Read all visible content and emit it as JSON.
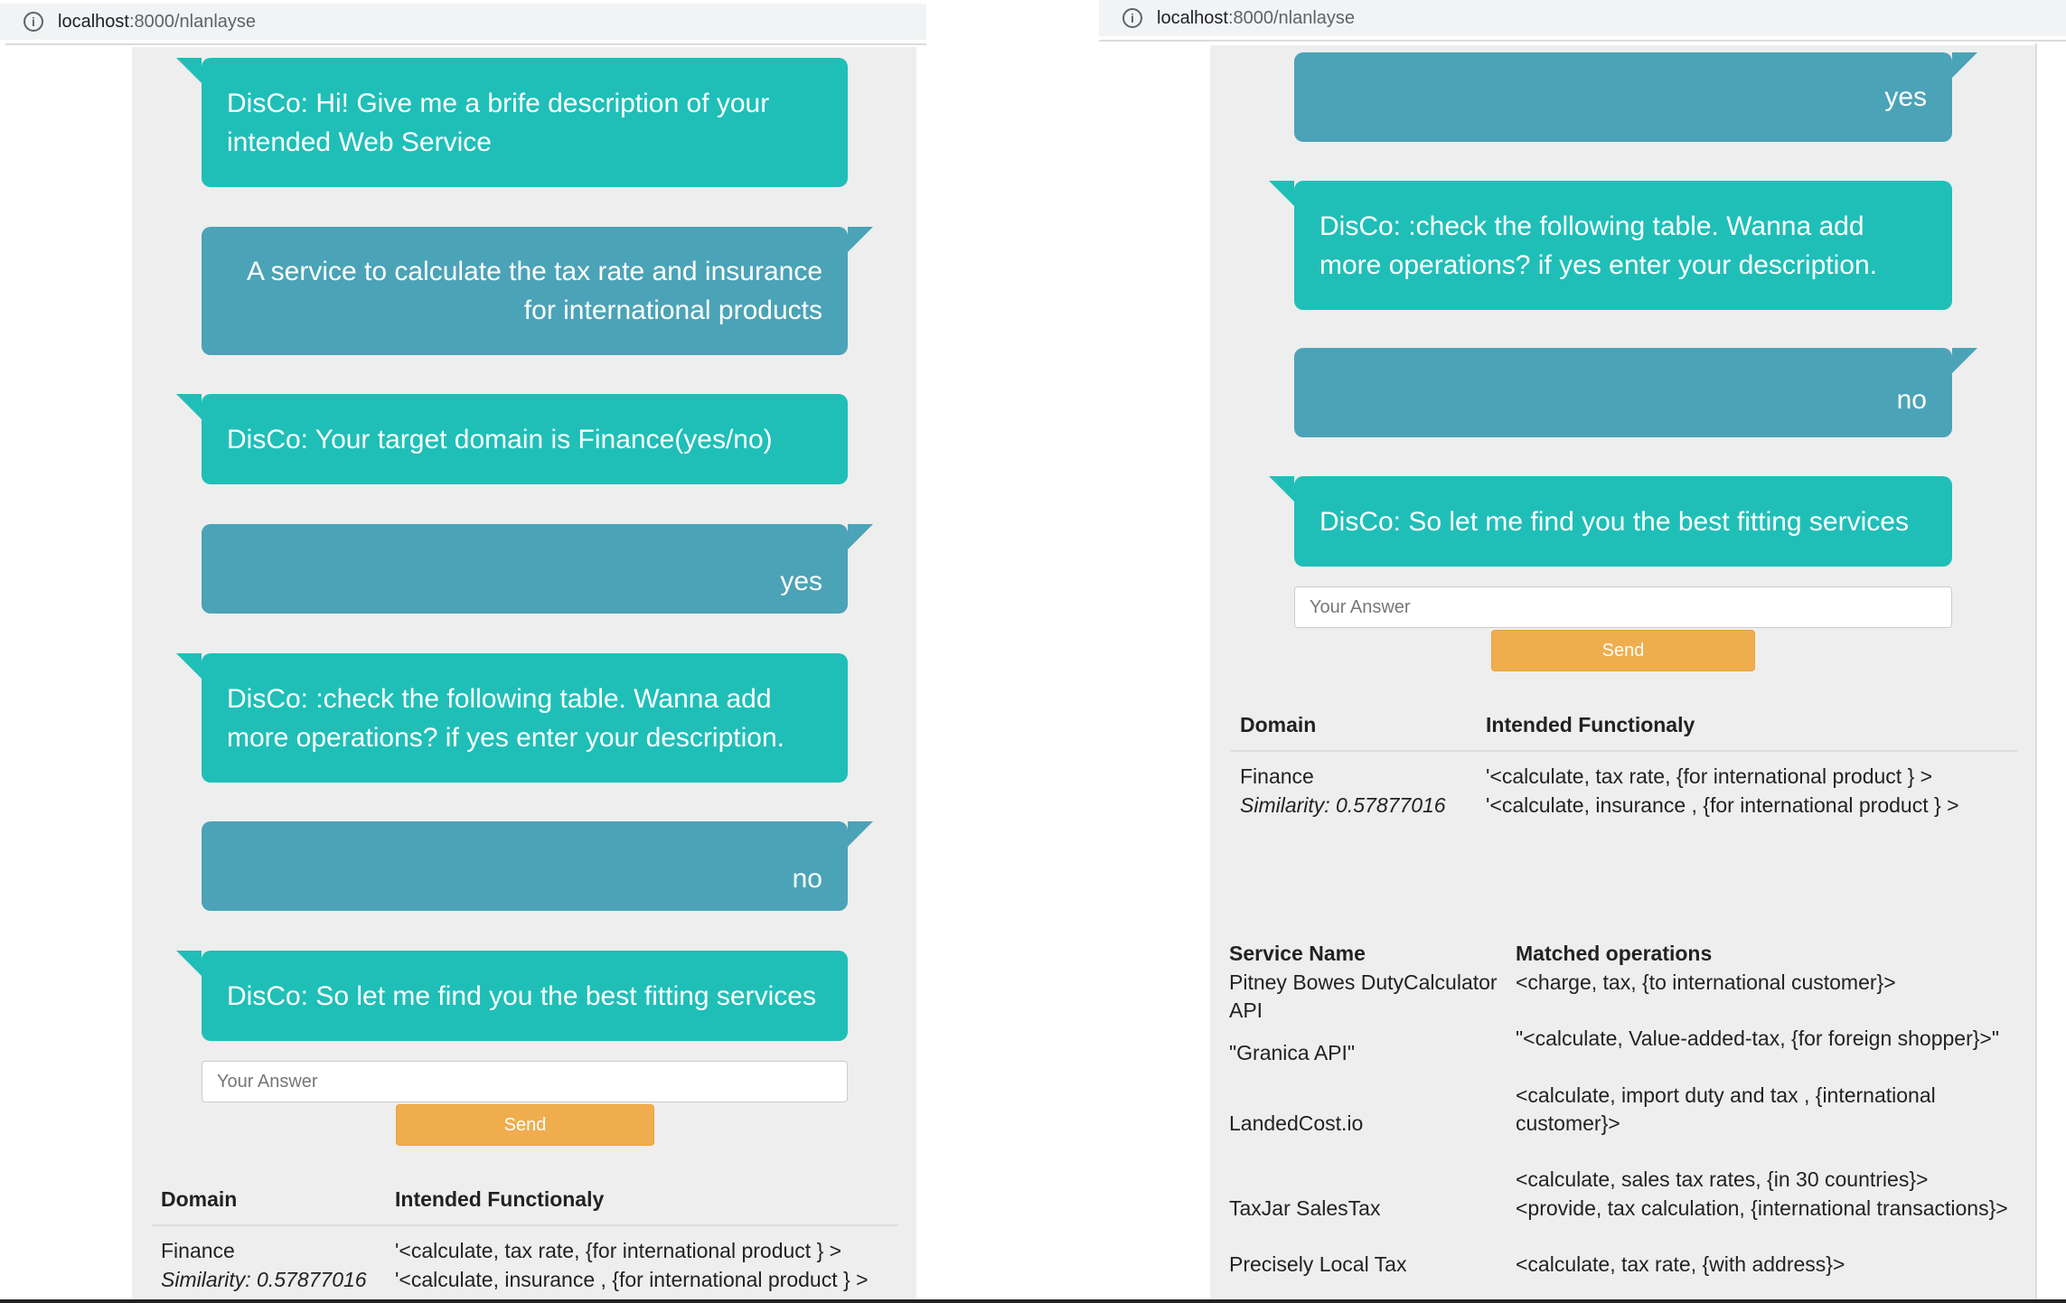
{
  "left": {
    "url": {
      "host": "localhost",
      "path": ":8000/nlanlayse"
    },
    "messages": [
      {
        "who": "bot",
        "lines": [
          "DisCo: Hi! Give me a brife description of your",
          "intended Web Service"
        ]
      },
      {
        "who": "user",
        "lines": [
          "A service to calculate the tax rate and insurance",
          "for international products"
        ]
      },
      {
        "who": "bot",
        "lines": [
          "DisCo: Your target domain is Finance(yes/no)"
        ]
      },
      {
        "who": "user",
        "lines": [
          "yes"
        ]
      },
      {
        "who": "bot",
        "lines": [
          "DisCo: :check the following table. Wanna add",
          "more operations? if yes enter your description."
        ]
      },
      {
        "who": "user",
        "lines": [
          "no"
        ]
      },
      {
        "who": "bot",
        "lines": [
          "DisCo: So let me find you the best fitting services"
        ]
      }
    ],
    "input_placeholder": "Your Answer",
    "send_label": "Send",
    "table": {
      "col_domain": "Domain",
      "col_func": "Intended Functionaly",
      "domain": "Finance",
      "similarity": "Similarity: 0.57877016",
      "func1": "'<calculate, tax rate, {for international product } >",
      "func2": "'<calculate, insurance , {for international product } >"
    }
  },
  "right": {
    "url": {
      "host": "localhost",
      "path": ":8000/nlanlayse"
    },
    "messages": [
      {
        "who": "user",
        "lines": [
          "yes"
        ]
      },
      {
        "who": "bot",
        "lines": [
          "DisCo: :check the following table. Wanna add",
          "more operations? if yes enter your description."
        ]
      },
      {
        "who": "user",
        "lines": [
          "no"
        ]
      },
      {
        "who": "bot",
        "lines": [
          "DisCo: So let me find you the best fitting services"
        ]
      }
    ],
    "input_placeholder": "Your Answer",
    "send_label": "Send",
    "table": {
      "col_domain": "Domain",
      "col_func": "Intended Functionaly",
      "domain": "Finance",
      "similarity": "Similarity: 0.57877016",
      "func1": "'<calculate, tax rate, {for international product } >",
      "func2": "'<calculate, insurance , {for international product } >"
    },
    "services": {
      "col_name": "Service Name",
      "col_ops": "Matched operations",
      "rows": [
        {
          "name": [
            "Pitney Bowes DutyCalculator",
            "API"
          ],
          "ops": [
            "<charge, tax, {to international customer}>"
          ]
        },
        {
          "name": [
            "\"Granica API\""
          ],
          "ops": [
            "\"<calculate, Value-added-tax, {for foreign shopper}>\""
          ]
        },
        {
          "name": [
            "LandedCost.io"
          ],
          "ops": [
            "<calculate, import duty and tax , {international",
            "customer}>"
          ]
        },
        {
          "name": [
            "TaxJar SalesTax"
          ],
          "ops": [
            "<calculate, sales tax rates, {in 30 countries}>",
            "<provide, tax calculation, {international transactions}>"
          ]
        },
        {
          "name": [
            "Precisely Local Tax"
          ],
          "ops": [
            "<calculate, tax rate, {with address}>"
          ]
        }
      ]
    }
  }
}
